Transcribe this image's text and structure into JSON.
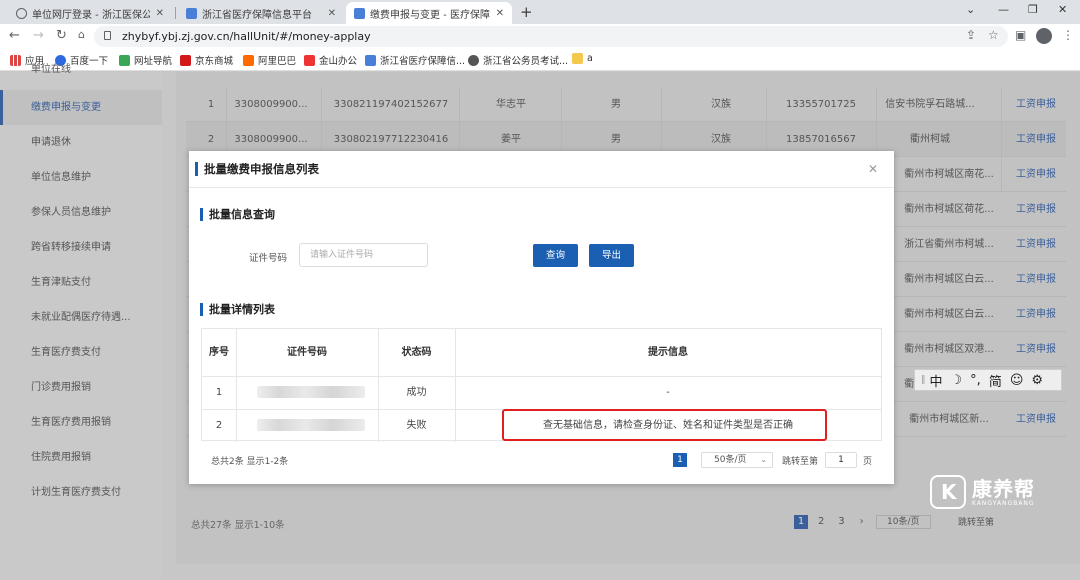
{
  "browser": {
    "tabs": [
      {
        "title": "单位网厅登录 - 浙江医保公共服务",
        "active": false
      },
      {
        "title": "浙江省医疗保障信息平台",
        "active": false
      },
      {
        "title": "缴费申报与变更 - 医疗保障单位网厅",
        "active": true
      }
    ],
    "url": "zhybyf.ybj.zj.gov.cn/hallUnit/#/money-applay",
    "bookmarks": [
      "应用",
      "百度一下",
      "网址导航",
      "京东商城",
      "阿里巴巴",
      "金山办公",
      "浙江省医疗保障信...",
      "浙江省公务员考试...",
      "a"
    ]
  },
  "sidebar": {
    "partial_top": "单位在线",
    "items": [
      {
        "label": "缴费申报与变更",
        "active": true
      },
      {
        "label": "申请退休"
      },
      {
        "label": "单位信息维护"
      },
      {
        "label": "参保人员信息维护"
      },
      {
        "label": "跨省转移接续申请"
      },
      {
        "label": "生育津贴支付"
      },
      {
        "label": "未就业配偶医疗待遇..."
      },
      {
        "label": "生育医疗费支付"
      },
      {
        "label": "门诊费用报销"
      },
      {
        "label": "生育医疗费用报销"
      },
      {
        "label": "住院费用报销"
      },
      {
        "label": "计划生育医疗费支付"
      }
    ]
  },
  "background_table": {
    "rows": [
      {
        "no": "1",
        "unit": "3308009900...",
        "id": "330821197402152677",
        "name": "华志平",
        "gender": "男",
        "nation": "汉族",
        "phone": "13355701725",
        "address": "信安书院孚石路城...",
        "action": "工资申报"
      },
      {
        "no": "2",
        "unit": "3308009900...",
        "id": "330802197712230416",
        "name": "姜平",
        "gender": "男",
        "nation": "汉族",
        "phone": "13857016567",
        "address": "衢州柯城",
        "action": "工资申报"
      }
    ],
    "right_partial": [
      {
        "addr": "衢州市柯城区南花...",
        "action": "工资申报"
      },
      {
        "addr": "衢州市柯城区荷花...",
        "action": "工资申报"
      },
      {
        "addr": "浙江省衢州市柯城...",
        "action": "工资申报"
      },
      {
        "addr": "衢州市柯城区白云...",
        "action": "工资申报"
      },
      {
        "addr": "衢州市柯城区白云...",
        "action": "工资申报"
      },
      {
        "addr": "衢州市柯城区双港...",
        "action": "工资申报"
      },
      {
        "addr": "衢州市衢江区绿江...",
        "action": "工资申报"
      },
      {
        "addr": "衢州市柯城区新...",
        "action": "工资申报"
      }
    ],
    "footer": "总共27条 显示1-10条",
    "pages": [
      "1",
      "2",
      "3"
    ],
    "page_size": "10条/页",
    "jump": "跳转至第"
  },
  "modal": {
    "title": "批量缴费申报信息列表",
    "query_section": "批量信息查询",
    "id_label": "证件号码",
    "id_placeholder": "请输入证件号码",
    "query_button": "查询",
    "export_button": "导出",
    "detail_section": "批量详情列表",
    "columns": [
      "序号",
      "证件号码",
      "状态码",
      "提示信息"
    ],
    "rows": [
      {
        "no": "1",
        "status": "成功",
        "message": "-"
      },
      {
        "no": "2",
        "status": "失败",
        "message": "查无基础信息，请检查身份证、姓名和证件类型是否正确"
      }
    ],
    "footer": "总共2条 显示1-2条",
    "current_page": "1",
    "page_size": "50条/页",
    "jump_label": "跳转至第",
    "jump_value": "1",
    "page_unit": "页"
  },
  "ime": [
    "中",
    "☽",
    "°,",
    "简",
    "☺",
    "⚙"
  ],
  "watermark": {
    "name": "康养帮",
    "sub": "KANGYANGBANG"
  }
}
